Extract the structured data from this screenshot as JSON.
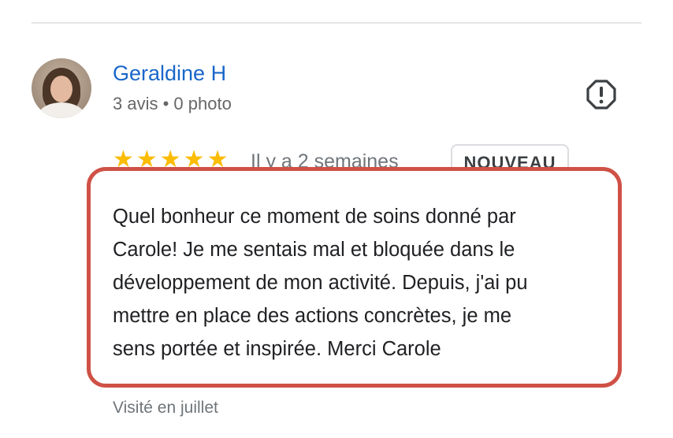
{
  "review": {
    "reviewer_name": "Geraldine H",
    "reviewer_meta": "3 avis • 0 photo",
    "rating": 5,
    "stars": "★★★★★",
    "date": "Il y a 2 semaines",
    "badge": "NOUVEAU",
    "text_lines": [
      "Quel bonheur ce moment de soins donné par",
      "Carole! Je me sentais mal et bloquée dans le",
      "développement de mon activité. Depuis, j'ai pu",
      "mettre en place des actions concrètes, je me",
      "sens portée et inspirée. Merci Carole"
    ],
    "visited": "Visité en juillet"
  },
  "icons": {
    "report": "exclamation-octagon-icon",
    "avatar": "profile-photo"
  },
  "colors": {
    "name_link": "#1a66c9",
    "stars": "#fbbc04",
    "highlight_border": "#cf5146"
  }
}
